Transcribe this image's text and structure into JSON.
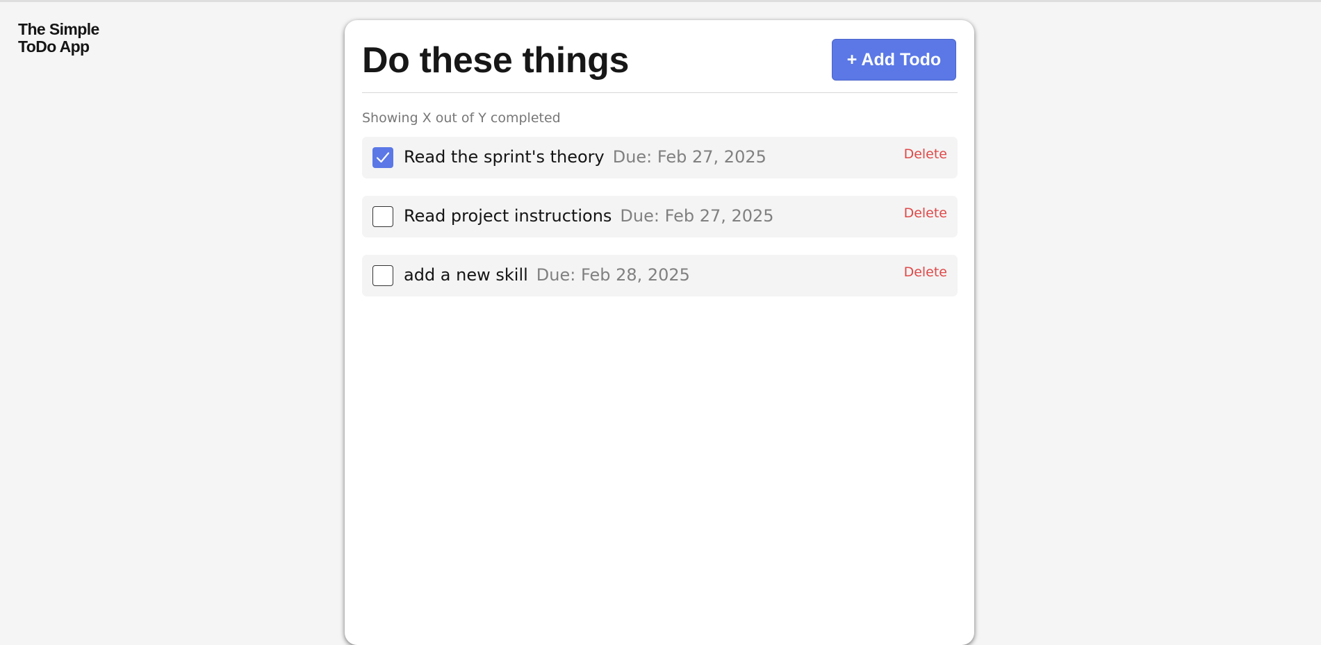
{
  "app": {
    "logo_line1": "The Simple",
    "logo_line2": "ToDo App"
  },
  "header": {
    "title": "Do these things",
    "add_button_label": "+ Add Todo"
  },
  "summary_text": "Showing X out of Y completed",
  "todos": [
    {
      "text": "Read the sprint's theory",
      "due": "Due: Feb 27, 2025",
      "completed": true,
      "delete_label": "Delete"
    },
    {
      "text": "Read project instructions",
      "due": "Due: Feb 27, 2025",
      "completed": false,
      "delete_label": "Delete"
    },
    {
      "text": "add a new skill",
      "due": "Due: Feb 28, 2025",
      "completed": false,
      "delete_label": "Delete"
    }
  ],
  "colors": {
    "accent": "#5b78e6",
    "danger": "#e04848",
    "background": "#f5f5f5",
    "card": "#ffffff",
    "item_background": "#f4f4f4"
  },
  "icons": {
    "checkbox_checked": "checkmark-icon"
  }
}
